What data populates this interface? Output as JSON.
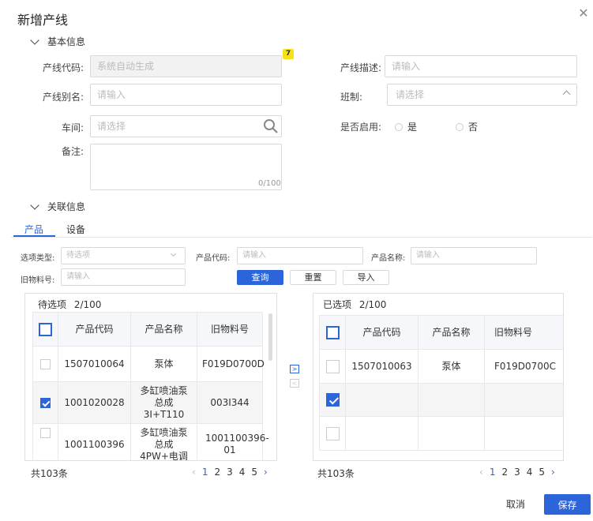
{
  "dialog": {
    "title": "新增产线"
  },
  "basic_section": {
    "label": "基本信息"
  },
  "form": {
    "code": {
      "label": "产线代码:",
      "placeholder": "系统自动生成",
      "badge": "7"
    },
    "alias": {
      "label": "产线别名:",
      "placeholder": "请输入"
    },
    "workshop": {
      "label": "车间:",
      "placeholder": "请选择"
    },
    "remark": {
      "label": "备注:",
      "counter": "0/100"
    },
    "desc": {
      "label": "产线描述:",
      "placeholder": "请输入"
    },
    "shift": {
      "label": "班制:",
      "placeholder": "请选择"
    },
    "enabled": {
      "label": "是否启用:",
      "options": [
        "是",
        "否"
      ]
    }
  },
  "related_section": {
    "label": "关联信息"
  },
  "tabs": [
    {
      "label": "产品",
      "active": true
    },
    {
      "label": "设备",
      "active": false
    }
  ],
  "filters": {
    "option_type": {
      "label": "选项类型:",
      "placeholder": "待选项"
    },
    "product_code": {
      "label": "产品代码:",
      "placeholder": "请输入"
    },
    "product_name": {
      "label": "产品名称:",
      "placeholder": "请输入"
    },
    "old_material": {
      "label": "旧物料号:",
      "placeholder": "请输入"
    },
    "query": "查询",
    "reset": "重置",
    "import": "导入"
  },
  "left_panel": {
    "title": "待选项",
    "count": "2/100",
    "columns": [
      "产品代码",
      "产品名称",
      "旧物料号"
    ],
    "rows": [
      {
        "checked": false,
        "code": "1507010064",
        "name": "泵体",
        "old": "F019D0700D"
      },
      {
        "checked": true,
        "code": "1001020028",
        "name": "多缸喷油泵总成3I+T110",
        "old": "003I344"
      },
      {
        "checked": false,
        "code": "1001100396",
        "name": "多缸喷油泵总成4PW+电调",
        "old": "1001100396-01"
      }
    ],
    "total": "共103条",
    "pages": [
      "1",
      "2",
      "3",
      "4",
      "5"
    ],
    "prev": "‹",
    "next": "›"
  },
  "right_panel": {
    "title": "已选项",
    "count": "2/100",
    "columns": [
      "产品代码",
      "产品名称",
      "旧物料号"
    ],
    "rows": [
      {
        "checked": false,
        "code": "1507010063",
        "name": "泵体",
        "old": "F019D0700C"
      },
      {
        "checked": true,
        "code": "",
        "name": "",
        "old": ""
      },
      {
        "checked": false,
        "code": "",
        "name": "",
        "old": ""
      }
    ],
    "total": "共103条",
    "pages": [
      "1",
      "2",
      "3",
      "4",
      "5"
    ],
    "prev": "‹",
    "next": "›"
  },
  "transfer": {
    "to_right": ">",
    "to_left": "<"
  },
  "footer": {
    "cancel": "取消",
    "save": "保存"
  },
  "colors": {
    "primary": "#2b65d9",
    "badge": "#f7e21a"
  }
}
